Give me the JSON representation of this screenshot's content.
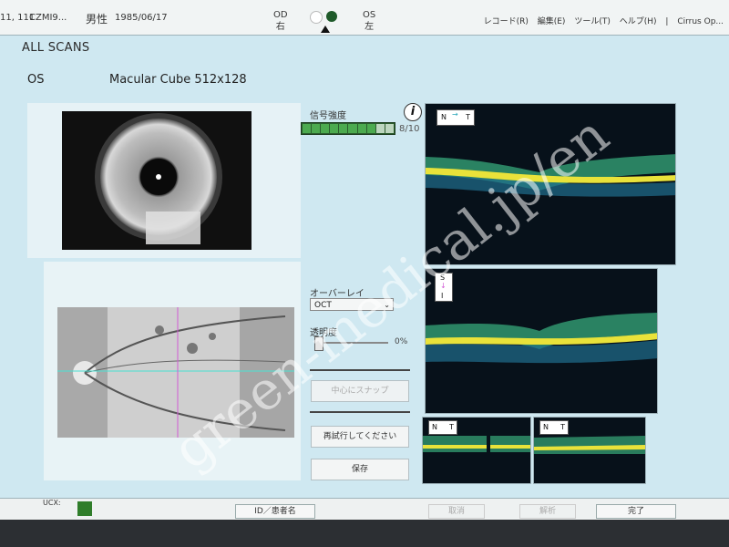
{
  "header": {
    "patient_id": "11, 111",
    "patient_name": "CZMI9...",
    "sex": "男性",
    "dob": "1985/06/17",
    "od_label": "OD",
    "od_kanji": "右",
    "os_label": "OS",
    "os_kanji": "左",
    "menu": [
      "レコード(R)",
      "編集(E)",
      "ツール(T)",
      "ヘルプ(H)",
      "|",
      "Cirrus Op..."
    ]
  },
  "main": {
    "section_title": "ALL SCANS",
    "eye": "OS",
    "scan_name": "Macular Cube 512x128"
  },
  "signal": {
    "label": "信号強度",
    "value_text": "8/10",
    "value": 8,
    "max": 10,
    "info_icon": "i"
  },
  "overlay": {
    "label": "オーバーレイ",
    "selected": "OCT"
  },
  "transparency": {
    "label": "透明度",
    "value_text": "0%",
    "value": 0
  },
  "buttons": {
    "snap_center": "中心にスナップ",
    "rescan": "再試行してください",
    "save": "保存"
  },
  "oct_tags": {
    "top": {
      "left": "N",
      "right": "T"
    },
    "middle": {
      "top": "S",
      "bottom": "I"
    },
    "bottom_left": {
      "left": "N",
      "right": "T"
    },
    "bottom_right": {
      "left": "N",
      "right": "T"
    }
  },
  "footer": {
    "ucx_label": "UCX:",
    "id_button": "ID／患者名",
    "cancel": "取消",
    "analyze": "解析",
    "finish": "完了"
  },
  "watermark": "green-medical.jp/en",
  "colors": {
    "screen_bg": "#cfe8f1",
    "signal_green": "#4caa4f",
    "status_green": "#2f7d2a",
    "oct_bg": "#07111a"
  }
}
